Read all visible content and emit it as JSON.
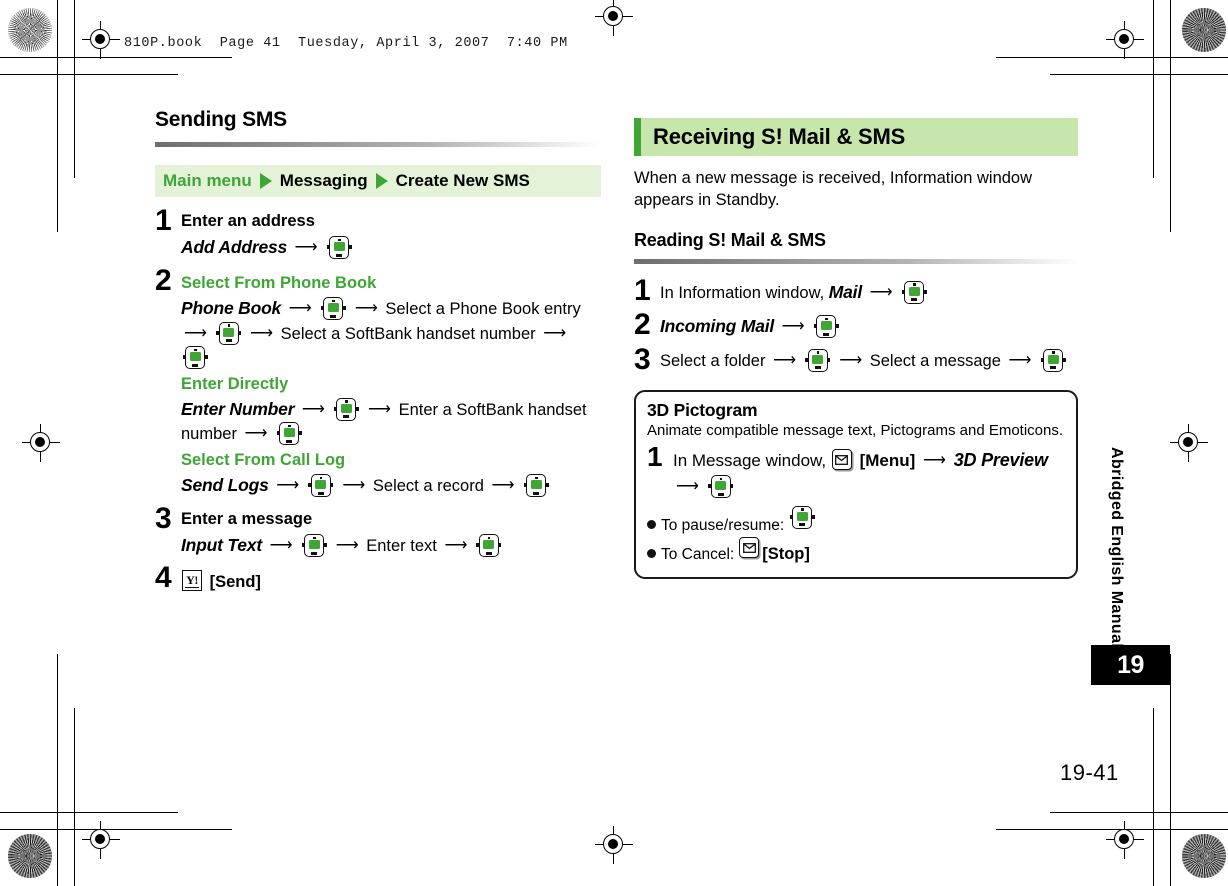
{
  "print_header": "810P.book  Page 41  Tuesday, April 3, 2007  7:40 PM",
  "colors": {
    "accent_green": "#3fa535",
    "band_green": "#c6e6ab",
    "breadcrumb_green": "#e4f2d8"
  },
  "left_column": {
    "heading": "Sending SMS",
    "breadcrumb": {
      "item1": "Main menu",
      "item2": "Messaging",
      "item3": "Create New SMS"
    },
    "steps": [
      {
        "number": "1",
        "title": "Enter an address",
        "lines": [
          {
            "cmd": "Add Address",
            "after": ""
          }
        ]
      },
      {
        "number": "2",
        "green_label_1": "Select From Phone Book",
        "line_1_cmd": "Phone Book",
        "line_1_mid": "Select a Phone Book entry",
        "line_1_mid2": "Select a SoftBank handset number",
        "green_label_2": "Enter Directly",
        "line_2_cmd": "Enter Number",
        "line_2_mid": "Enter a SoftBank handset number",
        "green_label_3": "Select From Call Log",
        "line_3_cmd": "Send Logs",
        "line_3_mid": "Select a record"
      },
      {
        "number": "3",
        "title": "Enter a message",
        "line_cmd": "Input Text",
        "line_mid": "Enter text"
      },
      {
        "number": "4",
        "key_label": "[Send]",
        "key_glyph": "Y!"
      }
    ]
  },
  "right_column": {
    "section_title": "Receiving S! Mail & SMS",
    "intro": "When a new message is received, Information window appears in Standby.",
    "sub_heading": "Reading S! Mail & SMS",
    "steps": [
      {
        "number": "1",
        "pre": "In Information window,",
        "cmd": "Mail"
      },
      {
        "number": "2",
        "cmd": "Incoming Mail"
      },
      {
        "number": "3",
        "part1": "Select a folder",
        "part2": "Select a message"
      }
    ],
    "callout": {
      "title": "3D Pictogram",
      "description": "Animate compatible message text, Pictograms and Emoticons.",
      "step_number": "1",
      "step_pre": "In Message window,",
      "step_menu_label": "[Menu]",
      "step_cmd": "3D Preview",
      "bullet_1_text": "To pause/resume:",
      "bullet_2_text": "To Cancel:",
      "bullet_2_key_label": "[Stop]"
    }
  },
  "side": {
    "manual_label": "Abridged English Manual",
    "chapter": "19",
    "page_number": "19-41"
  }
}
